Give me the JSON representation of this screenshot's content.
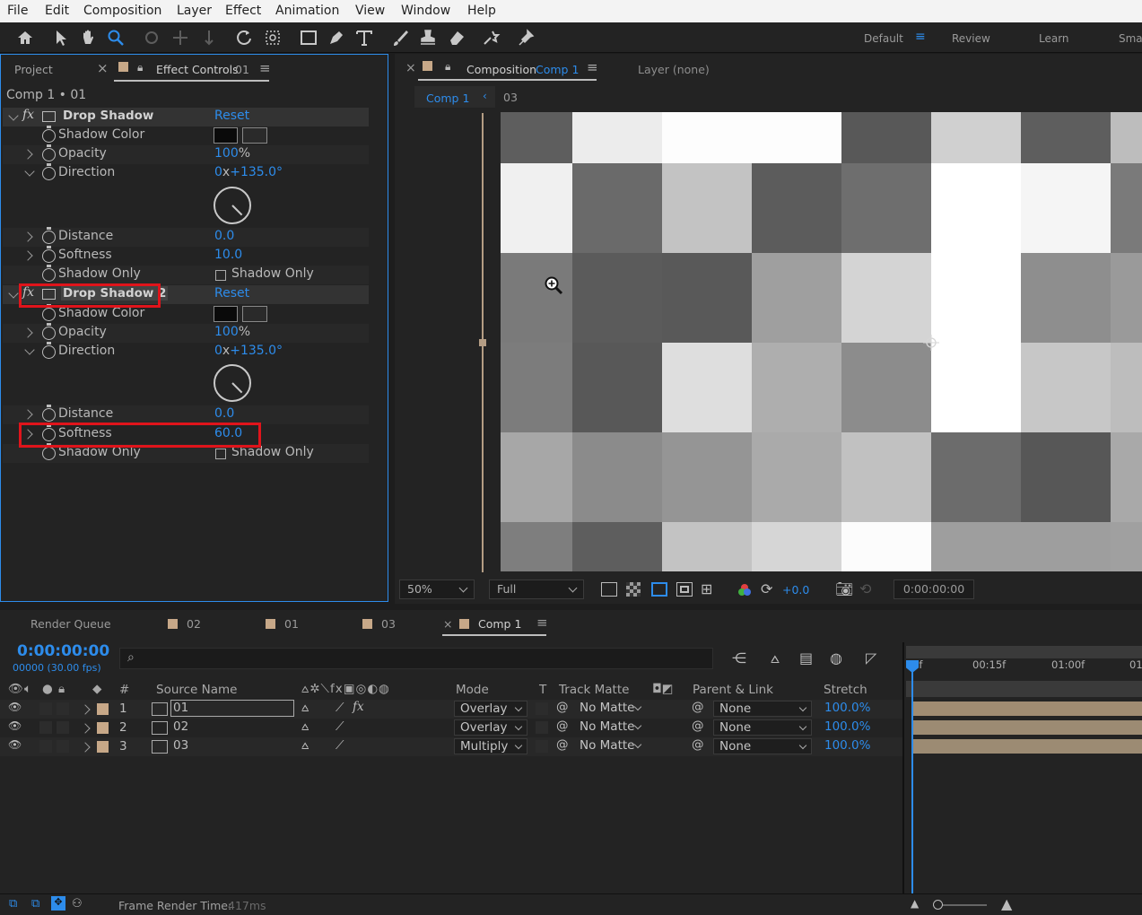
{
  "menu": [
    "File",
    "Edit",
    "Composition",
    "Layer",
    "Effect",
    "Animation",
    "View",
    "Window",
    "Help"
  ],
  "workspaces": {
    "default": "Default",
    "review": "Review",
    "learn": "Learn",
    "small": "Sma"
  },
  "left_panel": {
    "tab_project": "Project",
    "tab_effect_controls": "Effect Controls",
    "tab_effect_controls_layer": "01",
    "breadcrumb": "Comp 1 • 01",
    "effect1": {
      "name": "Drop Shadow",
      "reset": "Reset",
      "shadow_color_label": "Shadow Color",
      "opacity_label": "Opacity",
      "opacity_value": "100",
      "opacity_unit": "%",
      "direction_label": "Direction",
      "direction_rev": "0",
      "direction_x": "x",
      "direction_deg": "+135.0",
      "direction_unit": "°",
      "distance_label": "Distance",
      "distance_value": "0.0",
      "softness_label": "Softness",
      "softness_value": "10.0",
      "shadow_only_label": "Shadow Only",
      "shadow_only_check": "Shadow Only"
    },
    "effect2": {
      "name": "Drop Shadow 2",
      "reset": "Reset",
      "shadow_color_label": "Shadow Color",
      "opacity_label": "Opacity",
      "opacity_value": "100",
      "opacity_unit": "%",
      "direction_label": "Direction",
      "direction_rev": "0",
      "direction_x": "x",
      "direction_deg": "+135.0",
      "direction_unit": "°",
      "distance_label": "Distance",
      "distance_value": "0.0",
      "softness_label": "Softness",
      "softness_value": "60.0",
      "shadow_only_label": "Shadow Only",
      "shadow_only_check": "Shadow Only"
    }
  },
  "viewer": {
    "tab_composition": "Composition",
    "tab_composition_name": "Comp 1",
    "tab_layer": "Layer (none)",
    "nav_comp": "Comp 1",
    "nav_layer": "03",
    "zoom": "50%",
    "resolution": "Full",
    "exposure": "+0.0",
    "timecode": "0:00:00:00"
  },
  "grid_grays": [
    [
      "#5e5e5e",
      "#ececec",
      "#fdfdfd",
      "#fdfdfd",
      "#585858",
      "#d0d0d0",
      "#5e5e5e",
      "#bdbdbd"
    ],
    [
      "#f0f0f0",
      "#6a6a6a",
      "#c3c3c3",
      "#5c5c5c",
      "#6e6e6e",
      "#ffffff",
      "#f5f5f5",
      "#7a7a7a"
    ],
    [
      "#7a7a7a",
      "#5b5b5b",
      "#595959",
      "#9f9f9f",
      "#d4d4d4",
      "#ffffff",
      "#8e8e8e",
      "#9a9a9a"
    ],
    [
      "#7c7c7c",
      "#585858",
      "#dedede",
      "#aeaeae",
      "#8c8c8c",
      "#ffffff",
      "#c7c7c7",
      "#bdbdbd"
    ],
    [
      "#a7a7a7",
      "#8b8b8b",
      "#959595",
      "#aaaaaa",
      "#c1c1c1",
      "#6c6c6c",
      "#575757",
      "#a9a9a9"
    ],
    [
      "#7e7e7e",
      "#5e5e5e",
      "#c3c3c3",
      "#d6d6d6",
      "#fcfcfc",
      "#9e9e9e",
      "#9e9e9e",
      "#a0a0a0"
    ]
  ],
  "timeline": {
    "tabs": [
      "Render Queue",
      "02",
      "01",
      "03",
      "Comp 1"
    ],
    "timecode": "0:00:00:00",
    "frames": "00000 (30.00 fps)",
    "ruler": [
      "0f",
      "00:15f",
      "01:00f",
      "01"
    ],
    "headers": {
      "num": "#",
      "source": "Source Name",
      "mode": "Mode",
      "t": "T",
      "track_matte": "Track Matte",
      "parent": "Parent & Link",
      "stretch": "Stretch"
    },
    "layers": [
      {
        "num": "1",
        "name": "01",
        "mode": "Overlay",
        "matte": "No Matte",
        "parent": "None",
        "stretch": "100.0%"
      },
      {
        "num": "2",
        "name": "02",
        "mode": "Overlay",
        "matte": "No Matte",
        "parent": "None",
        "stretch": "100.0%"
      },
      {
        "num": "3",
        "name": "03",
        "mode": "Multiply",
        "matte": "No Matte",
        "parent": "None",
        "stretch": "100.0%"
      }
    ]
  },
  "status": {
    "frame_render_label": "Frame Render Time:",
    "frame_render_value": "417ms"
  },
  "colors": {
    "accent": "#2d8ceb",
    "highlight": "#e0141b",
    "label": "#c7a888"
  }
}
